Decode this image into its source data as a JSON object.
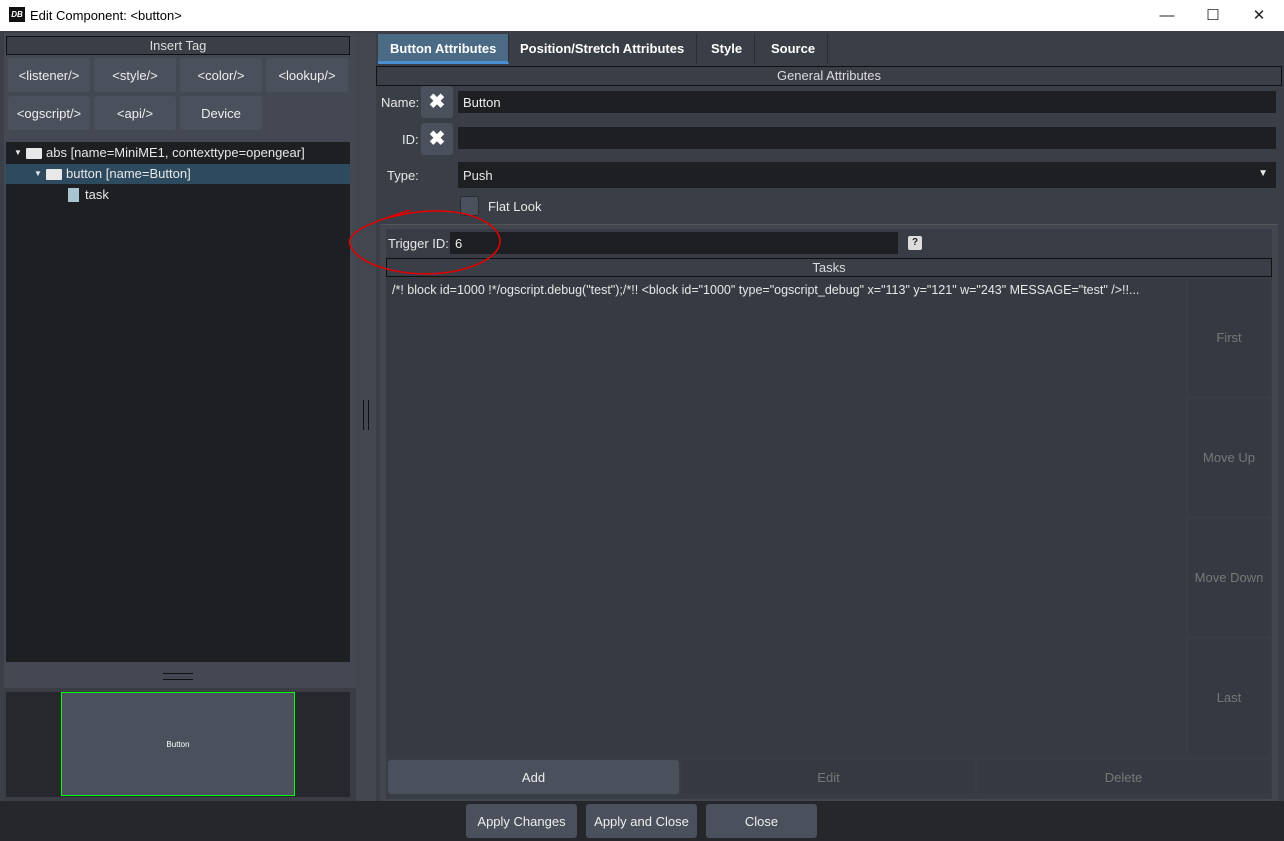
{
  "window": {
    "title": "Edit Component: <button>",
    "logo": "DB",
    "minimize": "—",
    "maximize": "☐",
    "close": "✕"
  },
  "insert_tag": {
    "header": "Insert Tag",
    "buttons": [
      "<listener/>",
      "<style/>",
      "<color/>",
      "<lookup/>",
      "<ogscript/>",
      "<api/>",
      "Device"
    ]
  },
  "tree": {
    "items": [
      {
        "label": "abs [name=MiniME1, contexttype=opengear]",
        "icon": "folder-open-icon"
      },
      {
        "label": "button [name=Button]",
        "icon": "folder-open-icon"
      },
      {
        "label": "task",
        "icon": "file-icon"
      }
    ]
  },
  "preview": {
    "label": "Button",
    "border_color": "#00ff00"
  },
  "tabs": [
    "Button Attributes",
    "Position/Stretch Attributes",
    "Style",
    "Source"
  ],
  "general": {
    "header": "General Attributes",
    "name_label": "Name:",
    "name_value": "Button",
    "id_label": "ID:",
    "id_value": "",
    "type_label": "Type:",
    "type_value": "Push",
    "flat_look_label": "Flat Look",
    "clear_glyph": "✖"
  },
  "tasks": {
    "trigger_label": "Trigger ID:",
    "trigger_value": "6",
    "help": "?",
    "header": "Tasks",
    "items": [
      "/*! block id=1000 !*/ogscript.debug(\"test\");/*!! <block id=\"1000\" type=\"ogscript_debug\" x=\"113\" y=\"121\" w=\"243\" MESSAGE=\"test\" />!!..."
    ],
    "side_buttons": [
      "First",
      "Move Up",
      "Move Down",
      "Last"
    ],
    "add": "Add",
    "edit": "Edit",
    "delete": "Delete"
  },
  "footer": {
    "apply_changes": "Apply Changes",
    "apply_close": "Apply and Close",
    "close": "Close"
  },
  "colors": {
    "accent": "#4a90d0",
    "annotation": "#e00000"
  }
}
